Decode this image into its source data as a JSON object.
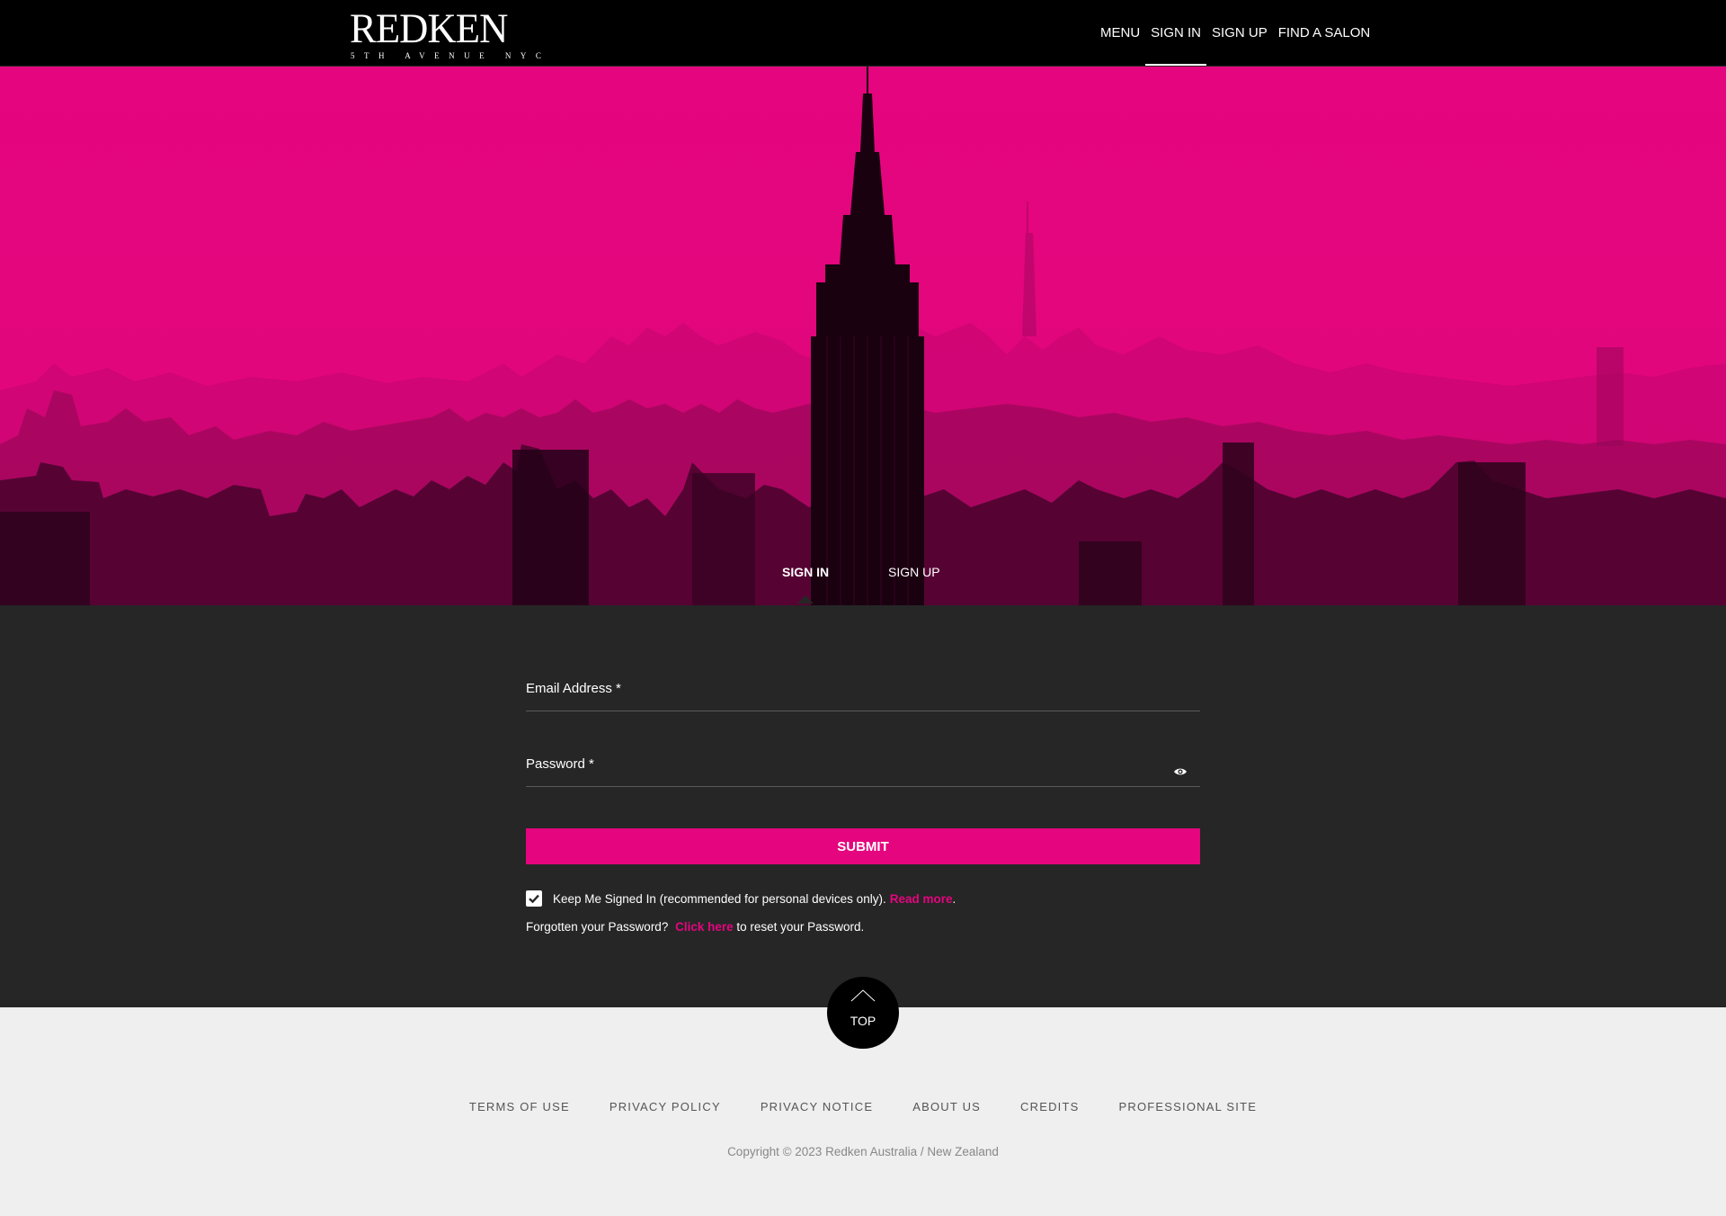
{
  "brand": {
    "name": "REDKEN",
    "tagline": "5TH AVENUE NYC"
  },
  "nav": {
    "items": [
      {
        "label": "MENU"
      },
      {
        "label": "SIGN IN",
        "active": true
      },
      {
        "label": "SIGN UP"
      },
      {
        "label": "FIND A SALON"
      }
    ]
  },
  "hero": {
    "tabs": [
      {
        "label": "SIGN IN",
        "active": true
      },
      {
        "label": "SIGN UP"
      }
    ]
  },
  "form": {
    "email_label": "Email Address *",
    "email_value": "",
    "password_label": "Password *",
    "password_value": "",
    "submit_label": "SUBMIT",
    "keep_signed_in_checked": true,
    "keep_signed_in_text": "Keep Me Signed In (recommended for personal devices only). ",
    "read_more_link": "Read more",
    "keep_signed_in_suffix": ".",
    "forgot_prefix": "Forgotten your Password? ",
    "forgot_link": "Click here",
    "forgot_suffix": " to reset your Password."
  },
  "top_button": {
    "label": "TOP"
  },
  "footer": {
    "links": [
      "TERMS OF USE",
      "PRIVACY POLICY",
      "PRIVACY NOTICE",
      "ABOUT US",
      "CREDITS",
      "PROFESSIONAL SITE"
    ],
    "copyright": "Copyright © 2023 Redken Australia / New Zealand"
  },
  "colors": {
    "accent": "#e5057e",
    "header_bg": "#000000",
    "form_bg": "#262626",
    "footer_bg": "#efefef"
  },
  "icons": {
    "password_toggle": "eye-icon",
    "checkbox": "checkmark-icon",
    "top": "chevron-up-icon"
  }
}
